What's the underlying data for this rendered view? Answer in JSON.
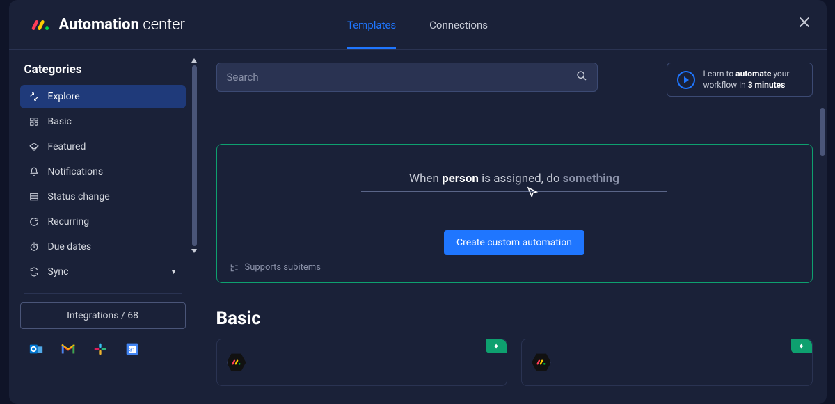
{
  "header": {
    "title_bold": "Automation",
    "title_light": "center",
    "tabs": [
      {
        "label": "Templates",
        "active": true
      },
      {
        "label": "Connections",
        "active": false
      }
    ]
  },
  "sidebar": {
    "title": "Categories",
    "items": [
      {
        "label": "Explore",
        "icon": "explore-icon",
        "active": true
      },
      {
        "label": "Basic",
        "icon": "basic-icon"
      },
      {
        "label": "Featured",
        "icon": "featured-icon"
      },
      {
        "label": "Notifications",
        "icon": "notifications-icon"
      },
      {
        "label": "Status change",
        "icon": "status-change-icon"
      },
      {
        "label": "Recurring",
        "icon": "recurring-icon"
      },
      {
        "label": "Due dates",
        "icon": "due-dates-icon"
      },
      {
        "label": "Sync",
        "icon": "sync-icon",
        "expandable": true
      }
    ],
    "integrations_label": "Integrations / 68",
    "integration_icons": [
      "outlook",
      "gmail",
      "slack",
      "google-calendar"
    ]
  },
  "search": {
    "placeholder": "Search"
  },
  "learn": {
    "line1_pre": "Learn to ",
    "line1_bold": "automate",
    "line1_post": " your",
    "line2_pre": "workflow in ",
    "line2_bold": "3 minutes"
  },
  "custom": {
    "when": "When ",
    "person": "person",
    "assigned": " is assigned, do ",
    "something": "something",
    "button": "Create custom automation",
    "supports": "Supports subitems"
  },
  "section": {
    "heading": "Basic"
  }
}
